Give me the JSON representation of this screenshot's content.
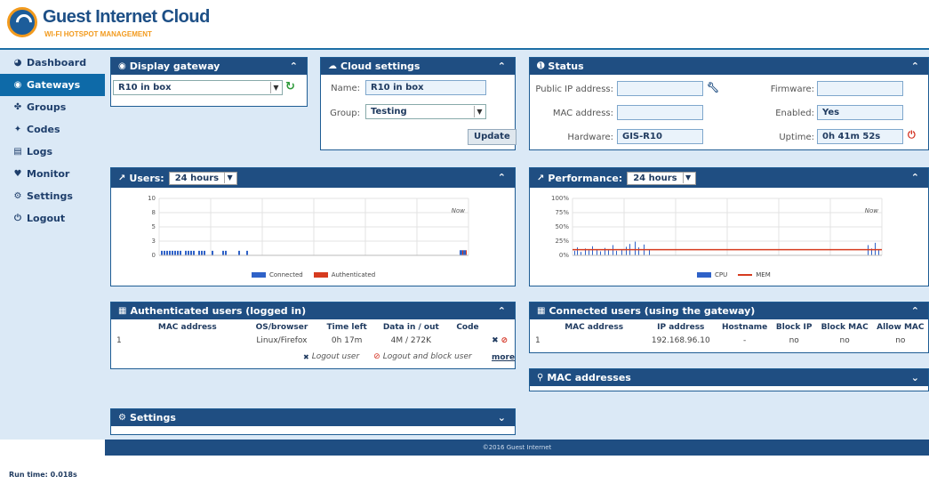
{
  "brand": {
    "title": "Guest Internet Cloud",
    "subtitle": "WI-FI HOTSPOT MANAGEMENT"
  },
  "nav": [
    {
      "label": "Dashboard",
      "icon": "dashboard-icon",
      "glyph": "◕",
      "active": false
    },
    {
      "label": "Gateways",
      "icon": "gateway-icon",
      "glyph": "◉",
      "active": true
    },
    {
      "label": "Groups",
      "icon": "groups-icon",
      "glyph": "✤",
      "active": false
    },
    {
      "label": "Codes",
      "icon": "codes-icon",
      "glyph": "✦",
      "active": false
    },
    {
      "label": "Logs",
      "icon": "logs-icon",
      "glyph": "▤",
      "active": false
    },
    {
      "label": "Monitor",
      "icon": "monitor-icon",
      "glyph": "♥",
      "active": false
    },
    {
      "label": "Settings",
      "icon": "settings-icon",
      "glyph": "⚙",
      "active": false
    },
    {
      "label": "Logout",
      "icon": "power-icon",
      "glyph": "⏻",
      "active": false
    }
  ],
  "display_gateway": {
    "title": "Display gateway",
    "selected": "R10 in box"
  },
  "cloud_settings": {
    "title": "Cloud settings",
    "name_label": "Name:",
    "name_value": "R10 in box",
    "group_label": "Group:",
    "group_value": "Testing",
    "update_label": "Update"
  },
  "status": {
    "title": "Status",
    "public_ip_label": "Public IP address:",
    "public_ip_value": "",
    "mac_label": "MAC address:",
    "mac_value": "",
    "hardware_label": "Hardware:",
    "hardware_value": "GIS-R10",
    "firmware_label": "Firmware:",
    "firmware_value": "",
    "enabled_label": "Enabled:",
    "enabled_value": "Yes",
    "uptime_label": "Uptime:",
    "uptime_value": "0h 41m 52s"
  },
  "users_panel": {
    "title": "Users:",
    "range": "24 hours"
  },
  "performance_panel": {
    "title": "Performance:",
    "range": "24 hours"
  },
  "chart_data": [
    {
      "type": "bar",
      "ylim": [
        0,
        10
      ],
      "yticks": [
        "10",
        "8",
        "5",
        "3",
        "0"
      ],
      "now_label": "Now",
      "series": [
        {
          "name": "Connected",
          "color": "#2f62c8",
          "values": [
            1,
            1,
            1,
            1,
            1,
            1,
            1,
            1,
            1,
            1,
            1,
            1,
            1,
            1,
            1,
            1,
            1,
            1,
            1,
            1
          ]
        },
        {
          "name": "Authenticated",
          "color": "#d63b1f",
          "values": [
            1,
            1
          ]
        }
      ]
    },
    {
      "type": "line",
      "ylim": [
        0,
        100
      ],
      "yticks": [
        "100%",
        "75%",
        "50%",
        "25%",
        "0%"
      ],
      "now_label": "Now",
      "series": [
        {
          "name": "CPU",
          "color": "#2f62c8"
        },
        {
          "name": "MEM",
          "color": "#d63b1f",
          "value": 10
        }
      ]
    }
  ],
  "auth_users": {
    "title": "Authenticated users (logged in)",
    "columns": [
      "MAC address",
      "OS/browser",
      "Time left",
      "Data in / out",
      "Code"
    ],
    "rows": [
      {
        "num": "1",
        "mac": "",
        "os": "Linux/Firefox",
        "time_left": "0h 17m",
        "data": "4M / 272K",
        "code": ""
      }
    ],
    "logout_label": "Logout user",
    "logout_block_label": "Logout and block user",
    "more_label": "more"
  },
  "connected_users": {
    "title": "Connected users (using the gateway)",
    "columns": [
      "MAC address",
      "IP address",
      "Hostname",
      "Block IP",
      "Block MAC",
      "Allow MAC"
    ],
    "rows": [
      {
        "num": "1",
        "mac": "",
        "ip": "192.168.96.10",
        "hostname": "-",
        "block_ip": "no",
        "block_mac": "no",
        "allow_mac": "no"
      }
    ]
  },
  "mac_addresses": {
    "title": "MAC addresses"
  },
  "settings_panel": {
    "title": "Settings"
  },
  "footer": {
    "copyright": "©2016 Guest Internet"
  },
  "runtime": "Run time: 0.018s"
}
